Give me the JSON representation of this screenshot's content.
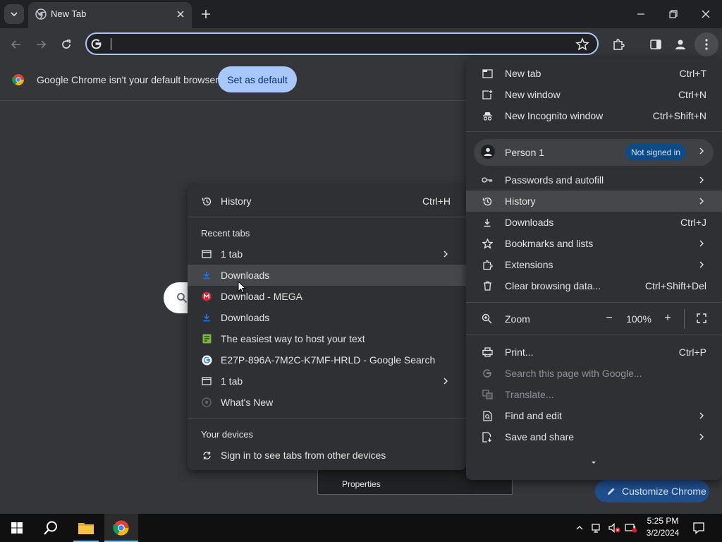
{
  "tab": {
    "title": "New Tab"
  },
  "omnibox": {
    "value": ""
  },
  "infobar": {
    "message": "Google Chrome isn't your default browser",
    "button": "Set as default"
  },
  "main_menu": {
    "items_top": [
      {
        "label": "New tab",
        "shortcut": "Ctrl+T"
      },
      {
        "label": "New window",
        "shortcut": "Ctrl+N"
      },
      {
        "label": "New Incognito window",
        "shortcut": "Ctrl+Shift+N"
      }
    ],
    "profile": {
      "name": "Person 1",
      "badge": "Not signed in"
    },
    "items_mid": [
      {
        "label": "Passwords and autofill",
        "shortcut": ""
      },
      {
        "label": "History",
        "shortcut": ""
      },
      {
        "label": "Downloads",
        "shortcut": "Ctrl+J"
      },
      {
        "label": "Bookmarks and lists",
        "shortcut": ""
      },
      {
        "label": "Extensions",
        "shortcut": ""
      },
      {
        "label": "Clear browsing data...",
        "shortcut": "Ctrl+Shift+Del"
      }
    ],
    "zoom": {
      "label": "Zoom",
      "minus": "−",
      "value": "100%",
      "plus": "+"
    },
    "items_bottom": [
      {
        "label": "Print...",
        "shortcut": "Ctrl+P"
      },
      {
        "label": "Search this page with Google...",
        "shortcut": ""
      },
      {
        "label": "Translate...",
        "shortcut": ""
      },
      {
        "label": "Find and edit",
        "shortcut": ""
      },
      {
        "label": "Save and share",
        "shortcut": ""
      }
    ]
  },
  "history_menu": {
    "header": {
      "label": "History",
      "shortcut": "Ctrl+H"
    },
    "recent_label": "Recent tabs",
    "recent": [
      {
        "label": "1 tab",
        "icon": "window-icon"
      },
      {
        "label": "Downloads",
        "icon": "download-icon"
      },
      {
        "label": "Download - MEGA",
        "icon": "mega-icon"
      },
      {
        "label": "Downloads",
        "icon": "download-icon"
      },
      {
        "label": "The easiest way to host your text",
        "icon": "site-icon"
      },
      {
        "label": "E27P-896A-7M2C-K7MF-HRLD - Google Search",
        "icon": "google-icon"
      },
      {
        "label": "1 tab",
        "icon": "window-icon"
      },
      {
        "label": "What's New",
        "icon": "chrome-icon"
      }
    ],
    "devices_label": "Your devices",
    "devices_item": "Sign in to see tabs from other devices"
  },
  "page": {
    "context_item": "Properties",
    "customize": "Customize Chrome"
  },
  "taskbar": {
    "time": "5:25 PM",
    "date": "3/2/2024"
  },
  "colors": {
    "accent": "#a8c7fa",
    "menu_bg": "#2f3034",
    "highlight": "#46474b",
    "badge": "#0e4a84"
  }
}
